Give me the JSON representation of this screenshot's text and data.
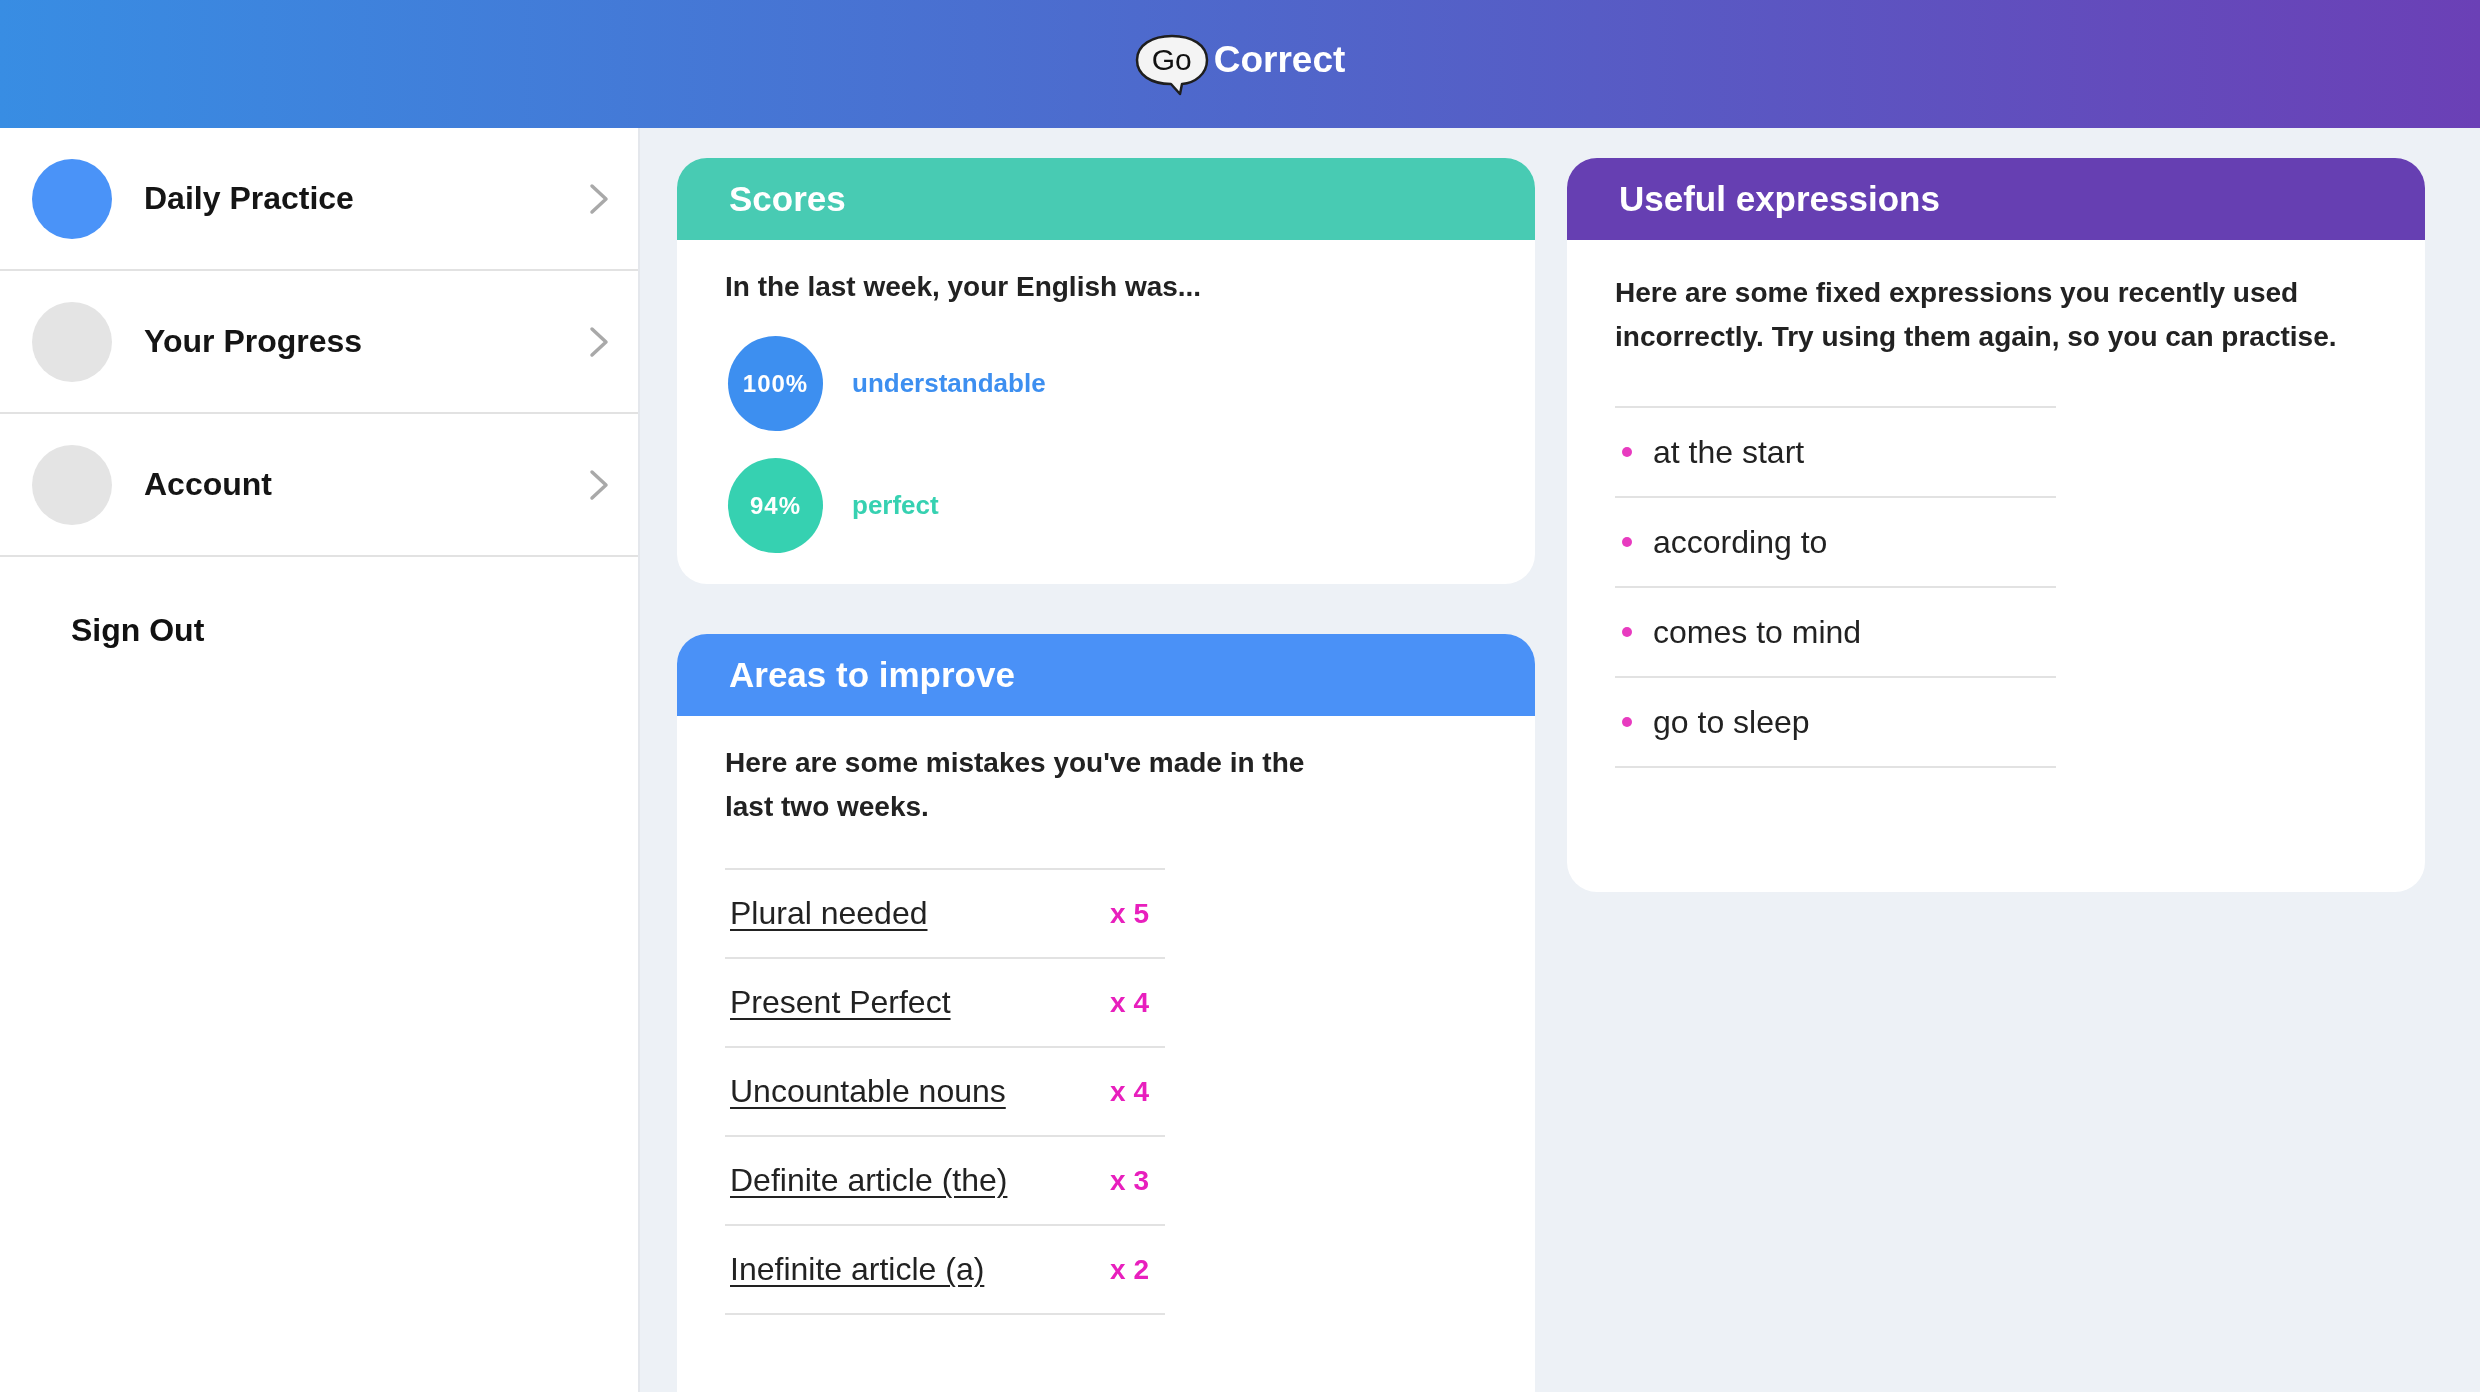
{
  "header": {
    "logo": {
      "bubble_text": "Go",
      "text": "Correct"
    }
  },
  "sidebar": {
    "items": [
      {
        "label": "Daily Practice",
        "selected": true
      },
      {
        "label": "Your Progress",
        "selected": false
      },
      {
        "label": "Account",
        "selected": false
      }
    ],
    "sign_out": "Sign Out"
  },
  "scores": {
    "title": "Scores",
    "intro": "In the last week, your English was...",
    "items": [
      {
        "value": "100%",
        "label": "understandable",
        "color": "#3d8ff0"
      },
      {
        "value": "94%",
        "label": "perfect",
        "color": "#36d1b1"
      }
    ]
  },
  "areas_to_improve": {
    "title": "Areas to improve",
    "intro": "Here are some mistakes you've made in the last two weeks.",
    "mistakes": [
      {
        "label": "Plural needed",
        "count": "x 5"
      },
      {
        "label": "Present Perfect",
        "count": "x 4"
      },
      {
        "label": "Uncountable nouns",
        "count": "x 4"
      },
      {
        "label": "Definite article (the)",
        "count": "x 3"
      },
      {
        "label": "Inefinite article (a)",
        "count": "x 2"
      }
    ]
  },
  "useful_expressions": {
    "title": "Useful expressions",
    "intro": "Here are some fixed expressions you recently used incorrectly. Try using them again, so you can practise.",
    "expressions": [
      "at the start",
      "according to",
      "comes to mind",
      "go to sleep"
    ]
  }
}
